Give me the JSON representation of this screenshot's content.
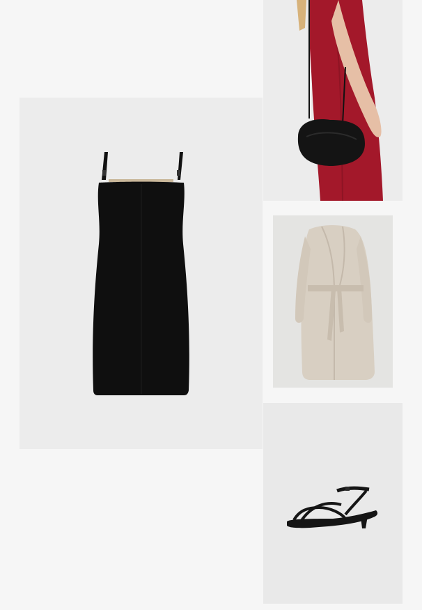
{
  "products": [
    {
      "name": "",
      "icon": "black-slip-dress-image"
    },
    {
      "name": "",
      "icon": "red-dress-black-bag-image"
    },
    {
      "name": "",
      "icon": "beige-wrap-coat-image"
    },
    {
      "name": "",
      "icon": "black-strappy-sandal-image"
    }
  ],
  "colors": {
    "page_background": "#f6f6f6",
    "tile_background": "#ececec",
    "dress": "#0f0f0f",
    "red_dress": "#a3182a",
    "bag": "#141414",
    "coat": "#d8cfc2",
    "sandal": "#151515"
  }
}
